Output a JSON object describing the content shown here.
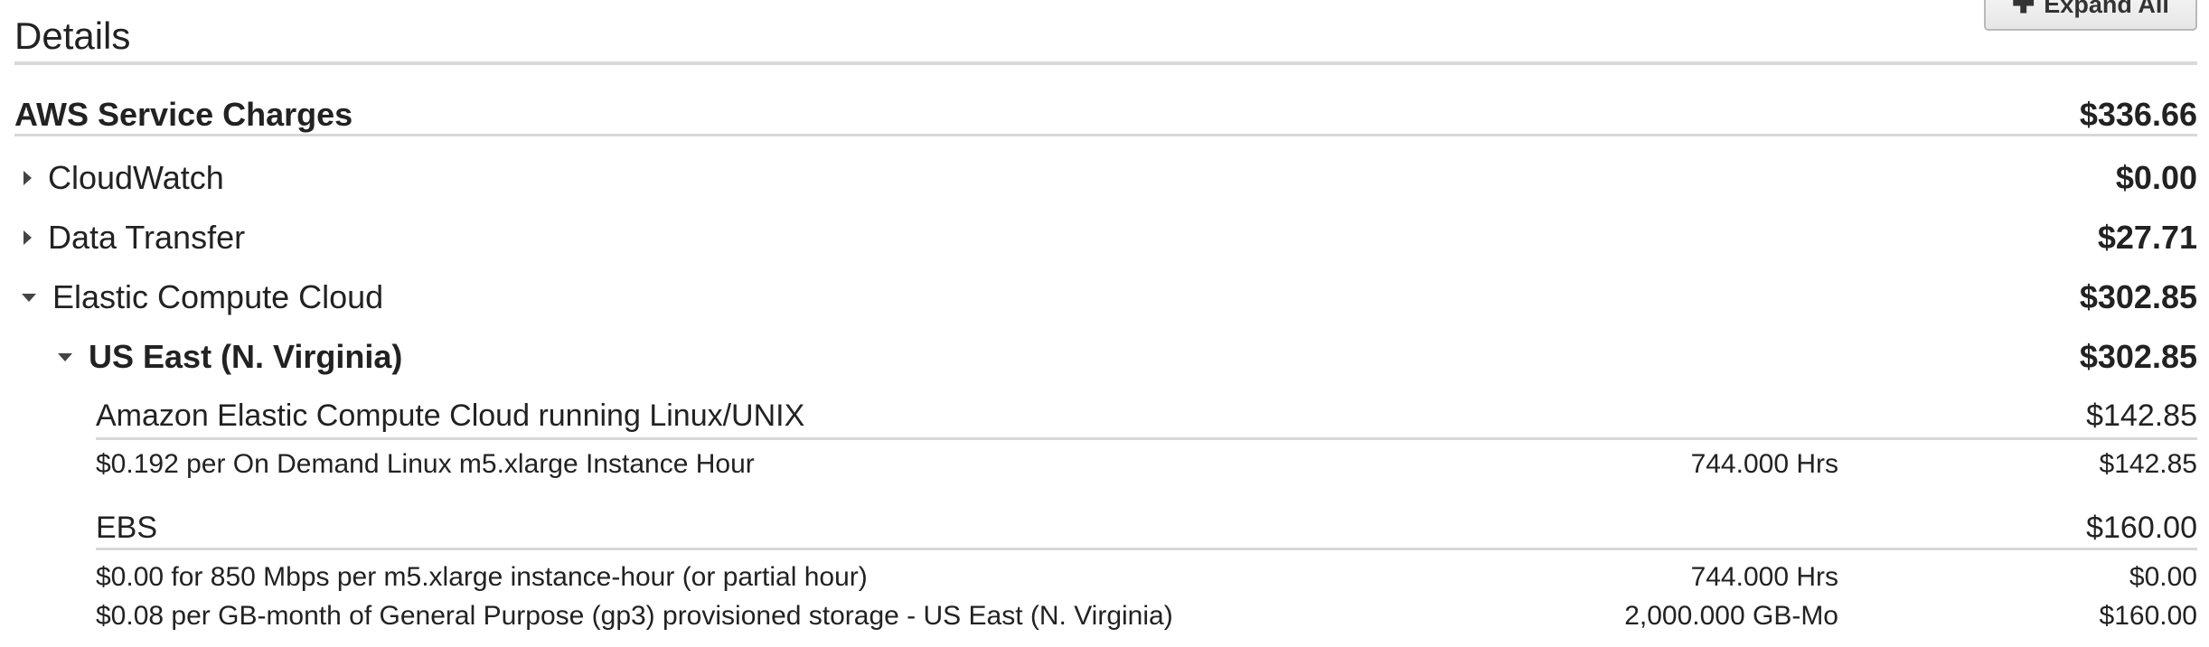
{
  "toolbar": {
    "expand_all_label": "Expand All",
    "expand_icon": "plus-icon"
  },
  "details": {
    "title": "Details"
  },
  "summary": {
    "label": "AWS Service Charges",
    "amount": "$336.66"
  },
  "services": {
    "cloudwatch": {
      "name": "CloudWatch",
      "amount": "$0.00",
      "expanded": false
    },
    "data_transfer": {
      "name": "Data Transfer",
      "amount": "$27.71",
      "expanded": false
    },
    "ec2": {
      "name": "Elastic Compute Cloud",
      "amount": "$302.85",
      "expanded": true,
      "region": {
        "name": "US East (N. Virginia)",
        "amount": "$302.85",
        "expanded": true,
        "groups": [
          {
            "name": "Amazon Elastic Compute Cloud running Linux/UNIX",
            "amount": "$142.85",
            "items": [
              {
                "description": "$0.192 per On Demand Linux m5.xlarge Instance Hour",
                "usage": "744.000 Hrs",
                "amount": "$142.85"
              }
            ]
          },
          {
            "name": "EBS",
            "amount": "$160.00",
            "items": [
              {
                "description": "$0.00 for 850 Mbps per m5.xlarge instance-hour (or partial hour)",
                "usage": "744.000 Hrs",
                "amount": "$0.00"
              },
              {
                "description": "$0.08 per GB-month of General Purpose (gp3) provisioned storage - US East (N. Virginia)",
                "usage": "2,000.000 GB-Mo",
                "amount": "$160.00"
              }
            ]
          }
        ]
      }
    }
  }
}
